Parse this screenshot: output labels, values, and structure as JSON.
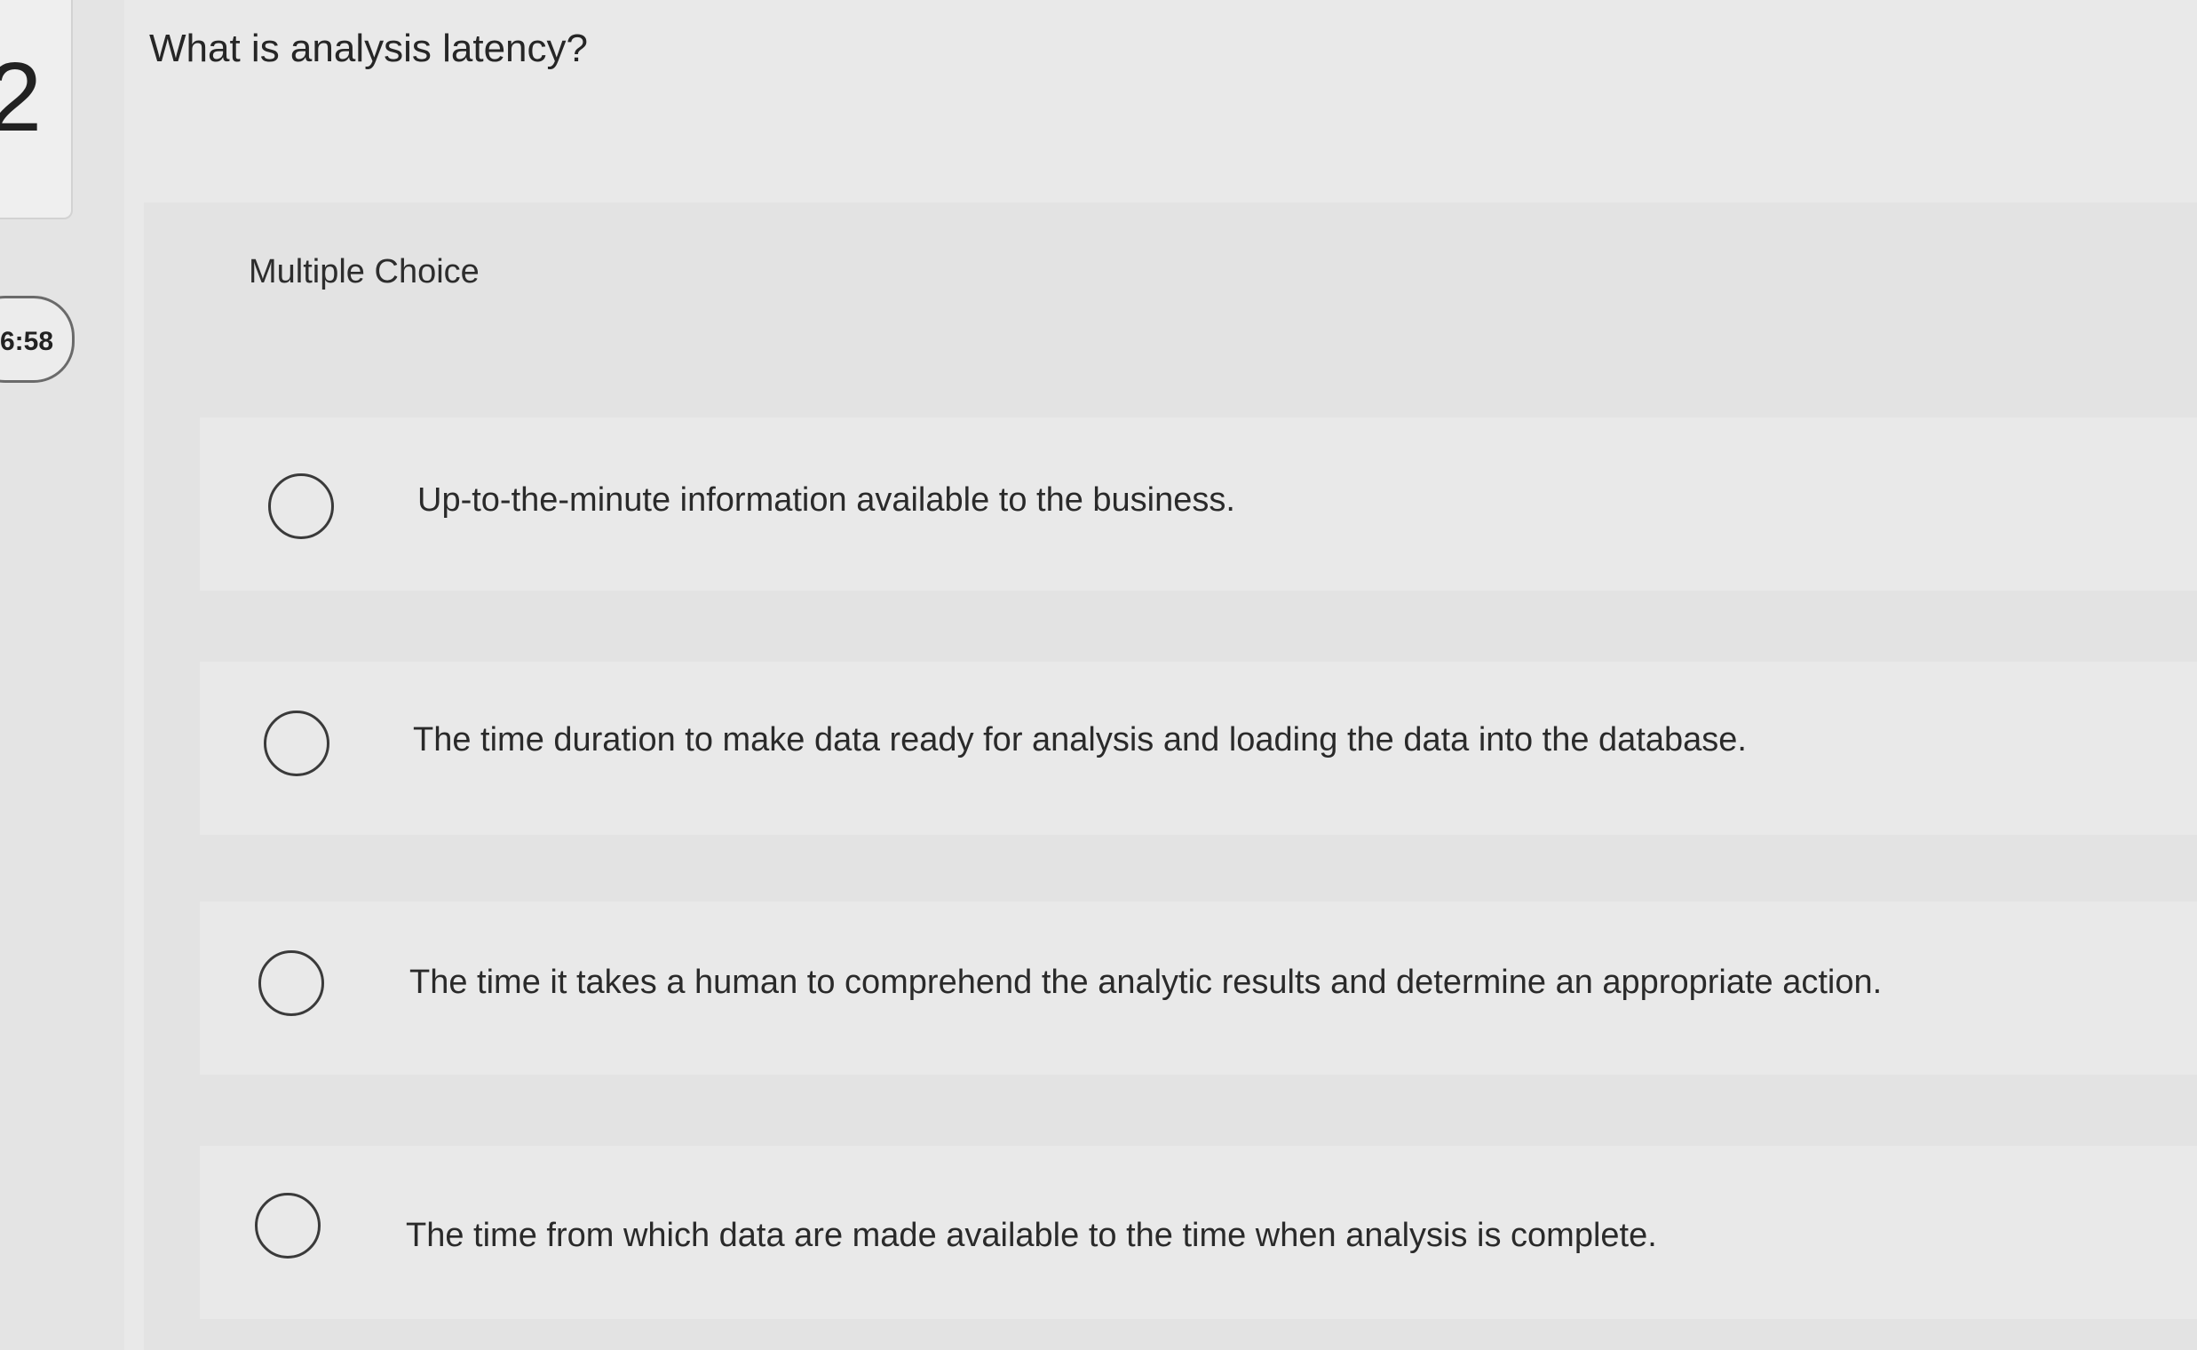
{
  "question": {
    "number": "2",
    "timer": "6:58",
    "title": "What is analysis latency?",
    "type_label": "Multiple Choice"
  },
  "options": [
    {
      "label": "Up-to-the-minute information available to the business.",
      "selected": false
    },
    {
      "label": "The time duration to make data ready for analysis and loading the data into the database.",
      "selected": false
    },
    {
      "label": "The time it takes a human to comprehend the analytic results and determine an appropriate action.",
      "selected": false
    },
    {
      "label": "The time from which data are made available to the time when analysis is complete.",
      "selected": false
    }
  ],
  "colors": {
    "background": "#e9e9e9",
    "panel": "#e3e3e3",
    "text": "#2a2a2a",
    "radio_border": "#3a3a3a"
  }
}
